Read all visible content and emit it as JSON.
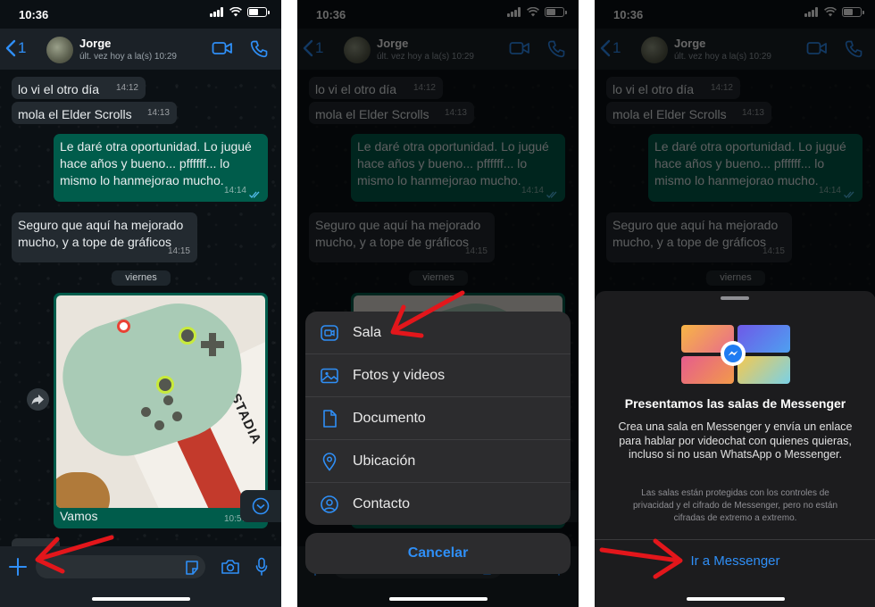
{
  "status": {
    "time": "10:36"
  },
  "chat": {
    "back_count": "1",
    "contact_name": "Jorge",
    "contact_status": "últ. vez hoy a la(s) 10:29",
    "messages": [
      {
        "text": "lo vi el otro día",
        "time": "14:12"
      },
      {
        "text": "mola el Elder Scrolls",
        "time": "14:13"
      },
      {
        "text": "Le daré otra oportunidad. Lo jugué hace años y bueno... pffffff... lo mismo lo hanmejorao mucho.",
        "time": "14:14"
      },
      {
        "text": "Seguro que aquí ha mejorado mucho, y a tope de gráficos",
        "time": "14:15"
      }
    ],
    "day_chip": "viernes",
    "image": {
      "caption": "Vamos",
      "time": "10:57",
      "box_text": "STADIA"
    },
    "hidden_time": "10:57"
  },
  "attach_menu": {
    "items": [
      {
        "label": "Sala",
        "icon": "video-room-icon"
      },
      {
        "label": "Fotos y videos",
        "icon": "photo-icon"
      },
      {
        "label": "Documento",
        "icon": "document-icon"
      },
      {
        "label": "Ubicación",
        "icon": "location-icon"
      },
      {
        "label": "Contacto",
        "icon": "contact-icon"
      }
    ],
    "cancel": "Cancelar"
  },
  "messenger_sheet": {
    "title": "Presentamos las salas de Messenger",
    "description": "Crea una sala en Messenger y envía un enlace para hablar por videochat con quienes quieras, incluso si no usan WhatsApp o Messenger.",
    "fineprint": "Las salas están protegidas con los controles de privacidad y el cifrado de Messenger, pero no están cifradas de extremo a extremo.",
    "button": "Ir a Messenger"
  },
  "colors": {
    "accent": "#2f8ff7",
    "outgoing_bubble": "#005c4b",
    "incoming_bubble": "#232a30",
    "annotation_arrow": "#e3161b"
  }
}
